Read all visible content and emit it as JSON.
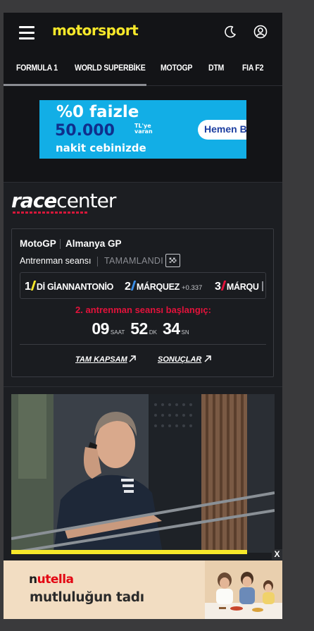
{
  "header": {
    "logo_text": "motorsport",
    "brand_color": "#f7e82a"
  },
  "nav": {
    "items": [
      {
        "label": "FORMULA 1"
      },
      {
        "label": "WORLD SUPERBİKE"
      },
      {
        "label": "MOTOGP"
      },
      {
        "label": "DTM"
      },
      {
        "label": "FIA F2"
      }
    ],
    "active_index": 1
  },
  "top_ad": {
    "line1": "%0 faizle",
    "line2": "50.000",
    "line2_suffix": "TL'ye varan",
    "line3": "nakit cebinizde",
    "button": "Hemen B"
  },
  "racecenter": {
    "logo_bold": "race",
    "logo_light": "center",
    "series": "MotoGP",
    "event": "Almanya GP",
    "session": "Antrenman seansı",
    "status": "TAMAMLANDI",
    "results": [
      {
        "pos": "1",
        "name": "Dİ GİANNANTONİO",
        "gap": "",
        "color": "#f7e82a"
      },
      {
        "pos": "2",
        "name": "MÁRQUEZ",
        "gap": "+0.337",
        "color": "#3a8ee6"
      },
      {
        "pos": "3",
        "name": "MÁRQU",
        "gap": "",
        "color": "#e3123b"
      }
    ],
    "countdown_label": "2. antrenman seansı başlangıç:",
    "countdown": {
      "hours": "09",
      "hours_unit": "SAAT",
      "minutes": "52",
      "minutes_unit": "DK",
      "seconds": "34",
      "seconds_unit": "SN"
    },
    "link_coverage": "TAM KAPSAM",
    "link_results": "SONUÇLAR",
    "alert_color": "#e3123b"
  },
  "article": {
    "image_subject": "person-on-phone-photo"
  },
  "bottom_ad": {
    "brand_first": "n",
    "brand_rest": "utella",
    "tagline": "mutluluğun tadı",
    "close_label": "X"
  }
}
